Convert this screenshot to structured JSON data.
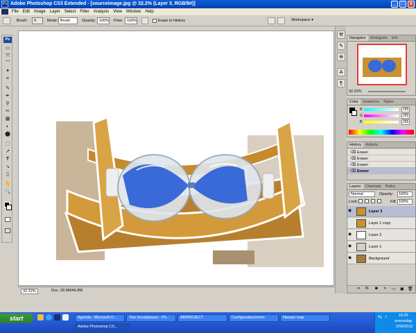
{
  "window": {
    "title": "Adobe Photoshop CS3 Extended - [sourceimage.jpg @ 32.2% (Layer 3, RGB/8#)]",
    "minimize": "_",
    "maximize": "□",
    "close": "x"
  },
  "menu": [
    "File",
    "Edit",
    "Image",
    "Layer",
    "Select",
    "Filter",
    "Analysis",
    "View",
    "Window",
    "Help"
  ],
  "options": {
    "brush_label": "Brush:",
    "brush_size": "9",
    "mode_label": "Mode:",
    "mode_value": "Brush",
    "opacity_label": "Opacity:",
    "opacity_value": "100%",
    "flow_label": "Flow:",
    "flow_value": "100%",
    "erase_history_label": "Erase to History",
    "workspace_label": "Workspace ▾"
  },
  "tools": [
    "▭",
    "⤧",
    "⌒",
    "✦",
    "⌗",
    "✎",
    "✒",
    "⚲",
    "✂",
    "▦",
    "◐",
    "⬤",
    "⬚",
    "↗",
    "T",
    "↘",
    "▯",
    "✋",
    "🔍",
    "■"
  ],
  "status": {
    "zoom": "32.22%",
    "doc": "Doc: 29.9M/46.8M"
  },
  "navigator": {
    "tabs": [
      "Navigator",
      "Histogram",
      "Info"
    ],
    "zoom": "32.22%"
  },
  "color": {
    "tabs": [
      "Color",
      "Swatches",
      "Styles"
    ],
    "r_label": "R",
    "g_label": "G",
    "b_label": "B",
    "r_value": "255",
    "g_value": "255",
    "b_value": "255"
  },
  "history": {
    "tabs": [
      "History",
      "Actions"
    ],
    "items": [
      "Eraser",
      "Eraser",
      "Eraser",
      "Eraser"
    ]
  },
  "layers": {
    "tabs": [
      "Layers",
      "Channels",
      "Paths"
    ],
    "blend_mode": "Normal",
    "opacity_label": "Opacity:",
    "opacity_value": "100%",
    "lock_label": "Lock:",
    "fill_label": "Fill:",
    "fill_value": "100%",
    "items": [
      {
        "name": "Layer 3"
      },
      {
        "name": "Layer 1 copy"
      },
      {
        "name": "Layer 2"
      },
      {
        "name": "Layer 1"
      },
      {
        "name": "Background"
      }
    ]
  },
  "taskbar": {
    "start": "start",
    "buttons": [
      "Agenda - Microsoft O...",
      "Two Hourglasses - Ph...",
      "ABPROJECT",
      "Configuratiescherm",
      "Nieuwe map",
      "Adobe Photoshop CS..."
    ],
    "clock": "16:25",
    "day": "woensdag",
    "date": "2/06/2010"
  },
  "colors": {
    "titlebar": "#0840b0",
    "hourglass_sand": "#3a6ad8",
    "wood": "#c9922f",
    "taskbar": "#245edb",
    "start_green": "#2c7d2c"
  }
}
